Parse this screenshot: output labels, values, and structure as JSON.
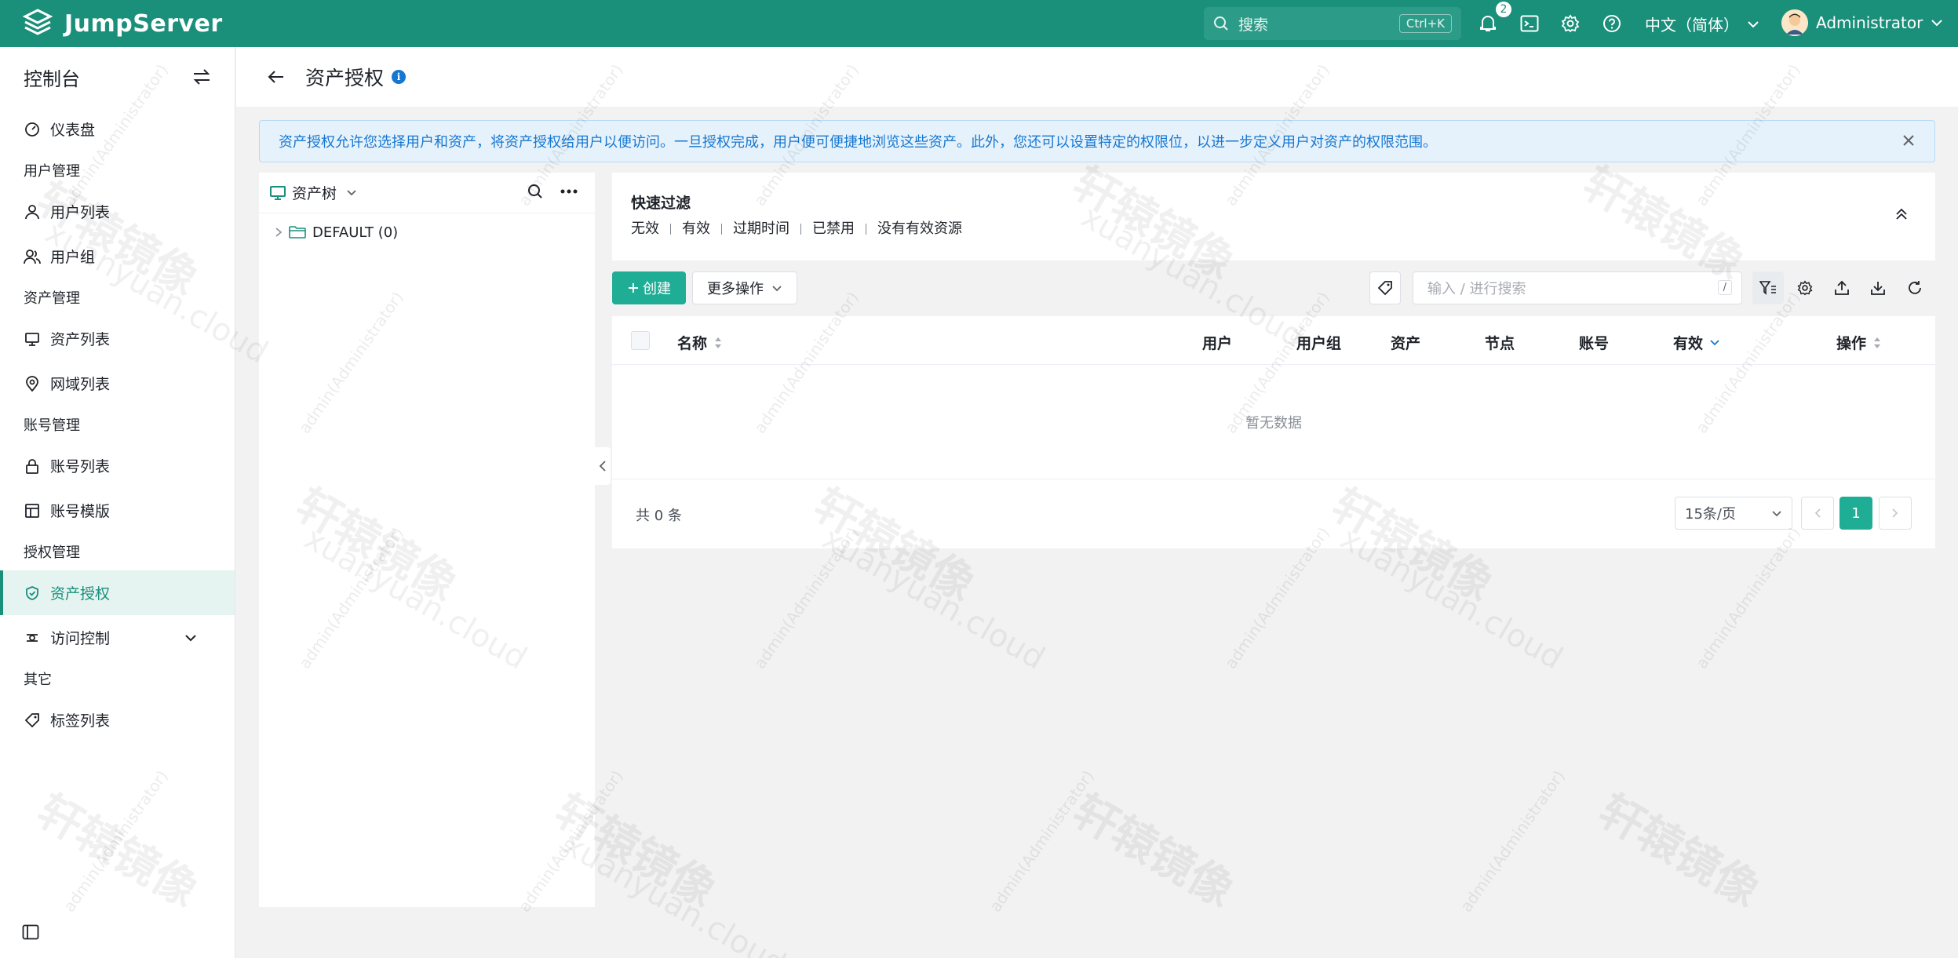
{
  "app": {
    "name": "JumpServer"
  },
  "topbar": {
    "search_label": "搜索",
    "search_shortcut": "Ctrl+K",
    "notification_count": "2",
    "language": "中文（简体）",
    "username": "Administrator"
  },
  "sidebar": {
    "title": "控制台",
    "dashboard": "仪表盘",
    "groups": {
      "users": "用户管理",
      "assets": "资产管理",
      "accounts": "账号管理",
      "perms": "授权管理",
      "other": "其它"
    },
    "items": {
      "user_list": "用户列表",
      "user_group": "用户组",
      "asset_list": "资产列表",
      "zone_list": "网域列表",
      "account_list": "账号列表",
      "account_template": "账号模版",
      "asset_permission": "资产授权",
      "access_control": "访问控制",
      "label_list": "标签列表"
    }
  },
  "page": {
    "title": "资产授权",
    "alert": "资产授权允许您选择用户和资产，将资产授权给用户以便访问。一旦授权完成，用户便可便捷地浏览这些资产。此外，您还可以设置特定的权限位，以进一步定义用户对资产的权限范围。"
  },
  "tree": {
    "title": "资产树",
    "node": "DEFAULT (0)"
  },
  "filter": {
    "title": "快速过滤",
    "items": [
      "无效",
      "有效",
      "过期时间",
      "已禁用",
      "没有有效资源"
    ]
  },
  "toolbar": {
    "create": "创建",
    "more": "更多操作",
    "search_placeholder": "输入 / 进行搜索",
    "search_shortcut": "/"
  },
  "table": {
    "columns": {
      "name": "名称",
      "user": "用户",
      "user_group": "用户组",
      "asset": "资产",
      "node": "节点",
      "account": "账号",
      "valid": "有效",
      "action": "操作"
    },
    "empty": "暂无数据"
  },
  "pager": {
    "total": "共 0 条",
    "page_size": "15条/页",
    "current": "1"
  },
  "watermark": {
    "name": "轩辕镜像",
    "url": "xuanyuan.cloud",
    "user": "admin(Administrator)"
  },
  "colors": {
    "brand": "#1a8f7a",
    "primary": "#1fae95",
    "info": "#1677d2"
  }
}
